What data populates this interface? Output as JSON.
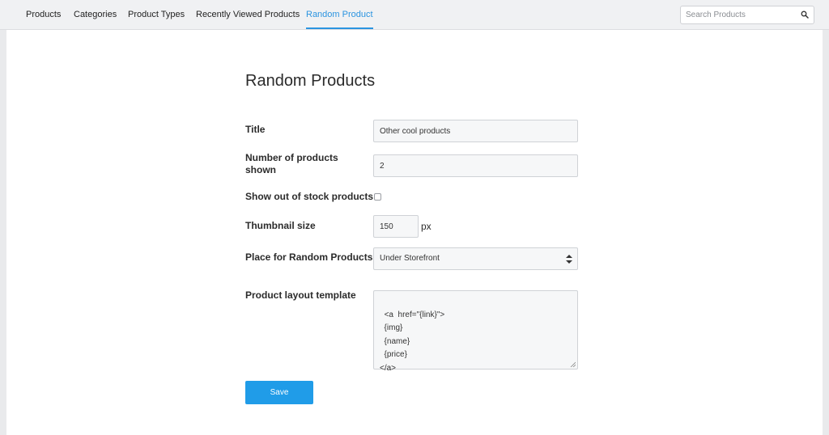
{
  "nav": {
    "tabs": [
      {
        "label": "Products"
      },
      {
        "label": "Categories"
      },
      {
        "label": "Product Types"
      },
      {
        "label": "Recently Viewed Products"
      },
      {
        "label": "Random Product",
        "active": true
      }
    ]
  },
  "search": {
    "placeholder": "Search Products",
    "icon": "search-icon"
  },
  "page": {
    "title": "Random Products"
  },
  "form": {
    "title": {
      "label": "Title",
      "value": "Other cool products"
    },
    "count": {
      "label": "Number of products\nshown",
      "value": "2"
    },
    "out_of_stock": {
      "label": "Show out of stock products",
      "checked": false
    },
    "thumbnail": {
      "label": "Thumbnail size",
      "value": "150",
      "unit": "px"
    },
    "place": {
      "label": "Place for Random Products",
      "value": "Under Storefront"
    },
    "template": {
      "label": "Product layout template",
      "value": "<a  href=\"{link}\">\n  {img}\n  {name}\n  {price}\n</a>"
    },
    "save_label": "Save"
  },
  "colors": {
    "accent": "#2b94e0",
    "button": "#209ce8",
    "background": "#e9eaec"
  }
}
